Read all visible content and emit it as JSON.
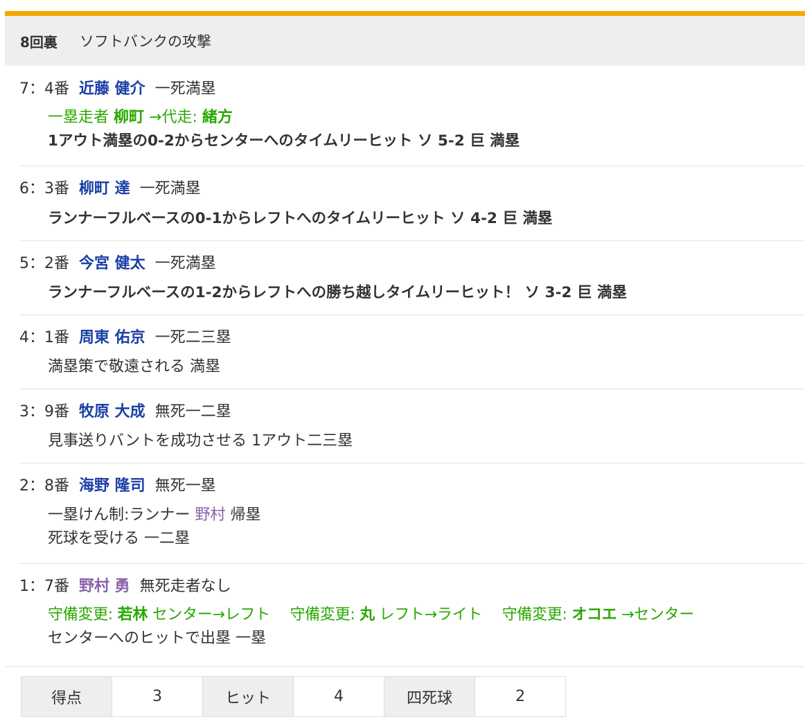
{
  "header": {
    "inning": "8回裏",
    "team_attack": "ソフトバンクの攻撃"
  },
  "plays": [
    {
      "number": "7：4番",
      "batter": "近藤 健介",
      "situation": "一死満塁",
      "sub_label": "一塁走者",
      "sub_runner": "柳町",
      "sub_arrow": "→代走:",
      "sub_new": "緒方",
      "result": "1アウト満塁の0-2からセンターへのタイムリーヒット ソ 5-2 巨 満塁"
    },
    {
      "number": "6：3番",
      "batter": "柳町 達",
      "situation": "一死満塁",
      "result": "ランナーフルベースの0-1からレフトへのタイムリーヒット ソ 4-2 巨 満塁"
    },
    {
      "number": "5：2番",
      "batter": "今宮 健太",
      "situation": "一死満塁",
      "result": "ランナーフルベースの1-2からレフトへの勝ち越しタイムリーヒット！ ソ 3-2 巨 満塁"
    },
    {
      "number": "4：1番",
      "batter": "周東 佑京",
      "situation": "一死二三塁",
      "result": "満塁策で敬遠される 満塁"
    },
    {
      "number": "3：9番",
      "batter": "牧原 大成",
      "situation": "無死一二塁",
      "result": "見事送りバントを成功させる 1アウト二三塁"
    },
    {
      "number": "2：8番",
      "batter": "海野 隆司",
      "situation": "無死一塁",
      "note_prefix": "一塁けん制:ランナー",
      "note_runner": "野村",
      "note_suffix": "帰塁",
      "result": "死球を受ける 一二塁"
    },
    {
      "number": "1：7番",
      "batter": "野村 勇",
      "situation": "無死走者なし",
      "changes": [
        {
          "label": "守備変更:",
          "player": "若林",
          "move": "センター→レフト"
        },
        {
          "label": "守備変更:",
          "player": "丸",
          "move": "レフト→ライト"
        },
        {
          "label": "守備変更:",
          "player": "オコエ",
          "move": "→センター"
        }
      ],
      "result": "センターへのヒットで出塁 一塁"
    }
  ],
  "stats": {
    "runs_label": "得点",
    "runs": "3",
    "hits_label": "ヒット",
    "hits": "4",
    "walks_label": "四死球",
    "walks": "2"
  },
  "colors": {
    "accent": "#f5a800",
    "batter": "#1a3fa6",
    "substitution": "#2aa800",
    "runner": "#8a62a8"
  }
}
